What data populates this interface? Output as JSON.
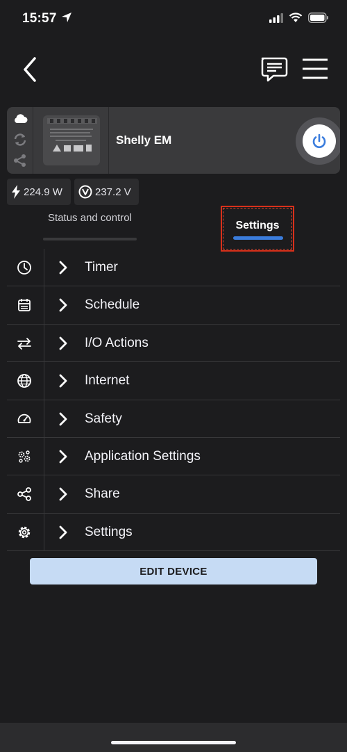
{
  "status_bar": {
    "time": "15:57"
  },
  "device": {
    "name": "Shelly EM"
  },
  "metrics": {
    "power": "224.9 W",
    "voltage": "237.2 V"
  },
  "tabs": {
    "status": "Status and control",
    "settings": "Settings"
  },
  "menu": [
    {
      "label": "Timer",
      "icon": "clock-icon"
    },
    {
      "label": "Schedule",
      "icon": "calendar-icon"
    },
    {
      "label": "I/O Actions",
      "icon": "arrows-icon"
    },
    {
      "label": "Internet",
      "icon": "globe-icon"
    },
    {
      "label": "Safety",
      "icon": "gauge-icon"
    },
    {
      "label": "Application Settings",
      "icon": "gears-icon"
    },
    {
      "label": "Share",
      "icon": "share-icon"
    },
    {
      "label": "Settings",
      "icon": "gear-icon"
    }
  ],
  "actions": {
    "edit_device": "EDIT DEVICE"
  },
  "colors": {
    "accent": "#3b7ddd",
    "background": "#1c1c1e",
    "button": "#c6dbf4",
    "highlight": "#d9301a"
  }
}
